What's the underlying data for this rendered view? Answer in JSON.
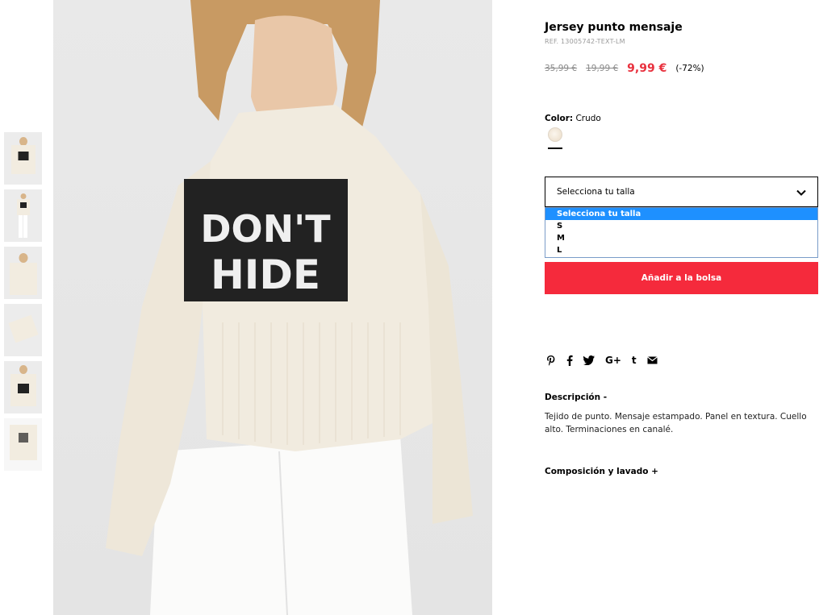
{
  "product": {
    "title": "Jersey punto mensaje",
    "ref": "REF. 13005742-TEXT-LM",
    "price_original": "35,99 €",
    "price_previous": "19,99 €",
    "price_current": "9,99 €",
    "discount": "(-72%)"
  },
  "image": {
    "print_line1": "DON'T",
    "print_line2": "HIDE"
  },
  "color": {
    "label": "Color:",
    "value": "Crudo",
    "swatch_color": "#f3ead8"
  },
  "size": {
    "placeholder": "Selecciona tu talla",
    "options": [
      "Selecciona tu talla",
      "S",
      "M",
      "L"
    ]
  },
  "add_to_bag": "Añadir a la bolsa",
  "share_icons": [
    "pinterest-icon",
    "facebook-icon",
    "twitter-icon",
    "google-plus-icon",
    "tumblr-icon",
    "email-icon"
  ],
  "description": {
    "header": "Descripción  -",
    "text": "Tejido de punto. Mensaje estampado. Panel en textura. Cuello alto. Terminaciones en canalé."
  },
  "composition": {
    "header": "Composición y lavado  +"
  },
  "colors": {
    "accent": "#f52a3c",
    "price": "#e8313e",
    "dropdown_highlight": "#1e90ff"
  }
}
